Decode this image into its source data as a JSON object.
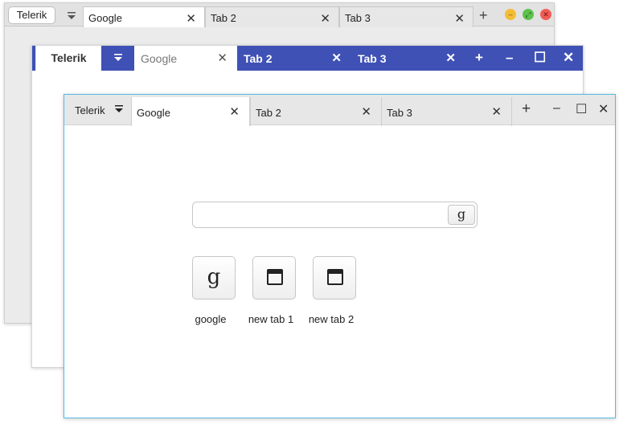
{
  "window_back": {
    "telerik_label": "Telerik",
    "tabs": [
      {
        "label": "Google"
      },
      {
        "label": "Tab 2"
      },
      {
        "label": "Tab 3"
      }
    ],
    "add_tab": "+",
    "close_glyph": "✕",
    "traffic_lights": {
      "minimize": "–",
      "maximize": "⤢",
      "close": "✕"
    },
    "traffic_colors": [
      "#f5bd37",
      "#5ec24c",
      "#f05c55"
    ]
  },
  "window_middle": {
    "telerik_label": "Telerik",
    "tabs": [
      {
        "label": "Google"
      },
      {
        "label": "Tab 2"
      },
      {
        "label": "Tab 3"
      }
    ],
    "add_tab": "+",
    "close_glyph": "✕",
    "controls": {
      "minimize": "–",
      "maximize": "☐",
      "close": "✕"
    },
    "accent_color": "#3f51b5"
  },
  "window_front": {
    "telerik_label": "Telerik",
    "tabs": [
      {
        "label": "Google"
      },
      {
        "label": "Tab 2"
      },
      {
        "label": "Tab 3"
      }
    ],
    "add_tab": "+",
    "close_glyph": "✕",
    "controls": {
      "minimize": "–",
      "maximize": "☐",
      "close": "✕"
    },
    "border_color": "#5ab8e0",
    "search": {
      "value": "",
      "button_glyph": "g"
    },
    "shortcuts": [
      {
        "label": "google",
        "icon": "google-g-icon",
        "glyph": "g"
      },
      {
        "label": "new tab 1",
        "icon": "browser-window-icon"
      },
      {
        "label": "new tab 2",
        "icon": "browser-window-icon"
      }
    ]
  }
}
